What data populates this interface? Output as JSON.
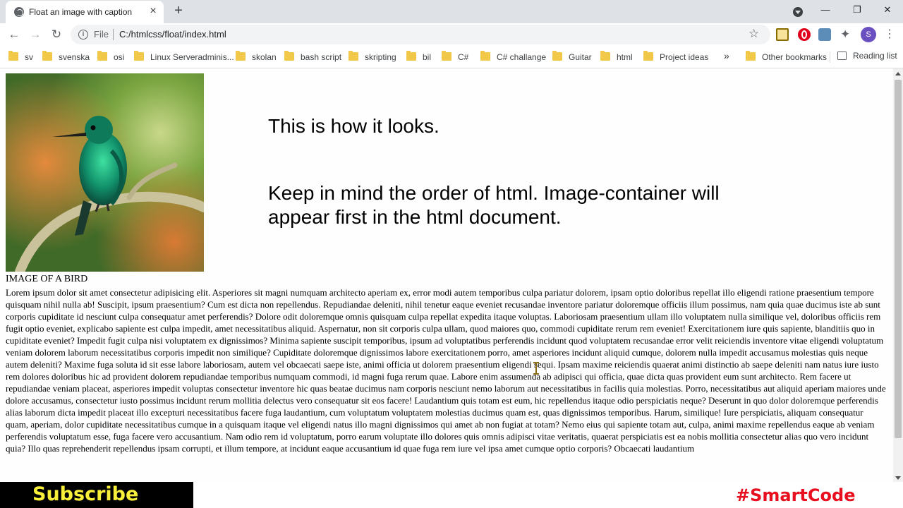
{
  "browser": {
    "tab_title": "Float an image with caption",
    "tab_close": "×",
    "new_tab": "+",
    "scheme": "File",
    "url": "C:/htmlcss/float/index.html",
    "avatar_letter": "S",
    "window_minimize": "—",
    "window_restore": "❐",
    "window_close": "✕"
  },
  "bookmarks": {
    "items": [
      {
        "label": "sv"
      },
      {
        "label": "svenska"
      },
      {
        "label": "osi"
      },
      {
        "label": "Linux Serveradminis..."
      },
      {
        "label": "skolan"
      },
      {
        "label": "bash script"
      },
      {
        "label": "skripting"
      },
      {
        "label": "bil"
      },
      {
        "label": "C#"
      },
      {
        "label": "C# challange"
      },
      {
        "label": "Guitar"
      },
      {
        "label": "html"
      },
      {
        "label": "Project ideas"
      }
    ],
    "more": "»",
    "other": "Other bookmarks",
    "reading_list": "Reading list"
  },
  "page": {
    "caption": "IMAGE OF A BIRD",
    "lead_1": "This is how it looks.",
    "lead_2": "Keep in mind the order of html. Image-container will appear first in the html document.",
    "body_text": "Lorem ipsum dolor sit amet consectetur adipisicing elit. Asperiores sit magni numquam architecto aperiam ex, error modi autem temporibus culpa pariatur dolorem, ipsam optio doloribus repellat illo eligendi ratione praesentium tempore quisquam nihil nulla ab! Suscipit, ipsum praesentium? Cum est dicta non repellendus. Repudiandae deleniti, nihil tenetur eaque eveniet recusandae inventore pariatur doloremque officiis illum possimus, nam quia quae ducimus iste ab sunt corporis cupiditate id nesciunt culpa consequatur amet perferendis? Dolore odit doloremque omnis quisquam culpa repellat expedita itaque voluptas. Laboriosam praesentium ullam illo voluptatem nulla similique vel, doloribus officiis rem fugit optio eveniet, explicabo sapiente est culpa impedit, amet necessitatibus aliquid. Aspernatur, non sit corporis culpa ullam, quod maiores quo, commodi cupiditate rerum rem eveniet! Exercitationem iure quis sapiente, blanditiis quo in cupiditate eveniet? Impedit fugit culpa nisi voluptatem ex dignissimos? Minima sapiente suscipit temporibus, ipsum ad voluptatibus perferendis incidunt quod voluptatem recusandae error velit reiciendis inventore vitae eligendi voluptatum veniam dolorem laborum necessitatibus corporis impedit non similique? Cupiditate doloremque dignissimos labore exercitationem porro, amet asperiores incidunt aliquid cumque, dolorem nulla impedit accusamus molestias quis neque autem deleniti? Maxime fuga soluta id sit esse labore laboriosam, autem vel obcaecati saepe iste, animi officia ut dolorem praesentium eligendi sequi. Ipsam maxime reiciendis quaerat animi distinctio ab saepe deleniti nam natus iure iusto rem dolores doloribus hic ad provident dolorem repudiandae temporibus numquam commodi, id magni fuga rerum quae. Labore enim assumenda ab adipisci qui officia, quae dicta quas provident eum sunt architecto. Rem facere ut repudiandae veniam placeat, asperiores impedit voluptas consectetur inventore hic quas beatae ducimus nam corporis nesciunt nemo laborum aut necessitatibus in facilis quia molestias. Porro, necessitatibus aut aliquid aperiam maiores unde dolore accusamus, consectetur iusto possimus incidunt rerum mollitia delectus vero consequatur sit eos facere! Laudantium quis totam est eum, hic repellendus itaque odio perspiciatis neque? Deserunt in quo dolor doloremque perferendis alias laborum dicta impedit placeat illo excepturi necessitatibus facere fuga laudantium, cum voluptatum voluptatem molestias ducimus quam est, quas dignissimos temporibus. Harum, similique! Iure perspiciatis, aliquam consequatur quam, aperiam, dolor cupiditate necessitatibus cumque in a quisquam itaque vel eligendi natus illo magni dignissimos qui amet ab non fugiat at totam? Nemo eius qui sapiente totam aut, culpa, animi maxime repellendus eaque ab veniam perferendis voluptatum esse, fuga facere vero accusantium. Nam odio rem id voluptatum, porro earum voluptate illo dolores quis omnis adipisci vitae veritatis, quaerat perspiciatis est ea nobis mollitia consectetur alias quo vero incidunt quia? Illo quas reprehenderit repellendus ipsam corrupti, et illum tempore, at incidunt eaque accusantium id quae fuga rem iure vel ipsa amet cumque optio corporis? Obcaecati laudantium"
  },
  "overlay": {
    "subscribe": "Subscribe",
    "channel_tag": "#SmartCode"
  },
  "colors": {
    "subscribe_text": "#f7ef3a",
    "channel_tag": "#e8101e",
    "tab_strip": "#dee1e6"
  }
}
